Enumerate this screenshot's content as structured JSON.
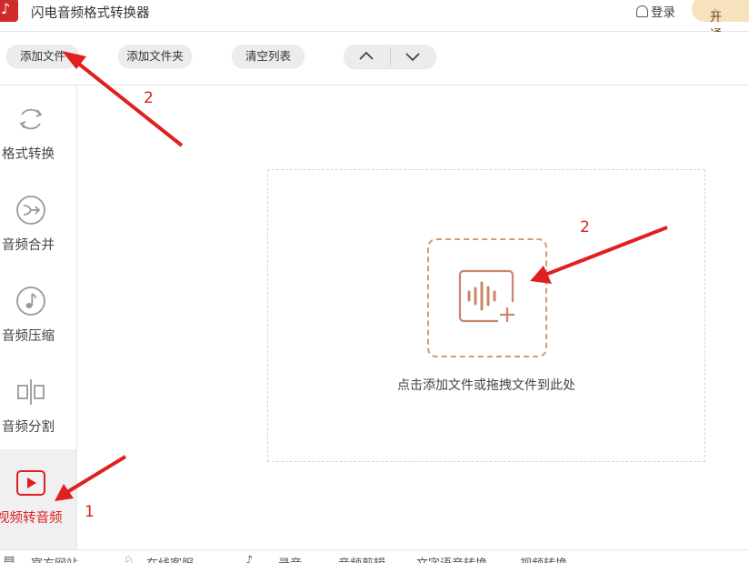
{
  "window": {
    "title": "闪电音频格式转换器",
    "login_label": "登录",
    "vip_label": "开通会员"
  },
  "toolbar": {
    "add_file": "添加文件",
    "add_folder": "添加文件夹",
    "clear_list": "清空列表"
  },
  "sidebar": {
    "items": [
      {
        "label": "格式转换",
        "icon": "refresh-icon"
      },
      {
        "label": "音频合并",
        "icon": "merge-icon"
      },
      {
        "label": "音频压缩",
        "icon": "music-note-icon"
      },
      {
        "label": "音频分割",
        "icon": "split-icon"
      },
      {
        "label": "视频转音频",
        "icon": "video-play-icon",
        "active": true
      }
    ]
  },
  "main": {
    "drop_hint": "点击添加文件或拖拽文件到此处"
  },
  "footer": {
    "items": [
      "官方网站",
      "在线客服",
      "录音",
      "音频剪辑",
      "文字语音转换",
      "视频转换"
    ]
  },
  "annotations": {
    "label_1": "1",
    "label_2a": "2",
    "label_2b": "2",
    "color": "#e02020"
  },
  "colors": {
    "accent": "#e02020",
    "drop_icon": "#c9866a",
    "vip_bg": "#f7e2be"
  }
}
